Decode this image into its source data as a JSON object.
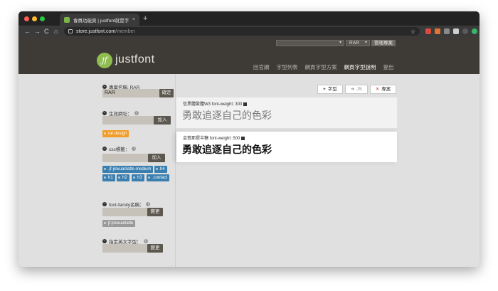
{
  "browser": {
    "tab_title": "會員功能頁 | justfont就是字・線上…",
    "tab_close": "×",
    "new_tab": "+",
    "url_host": "store.justfont.com",
    "url_path": "/member",
    "nav_back": "←",
    "nav_forward": "→",
    "nav_reload": "C",
    "nav_home": "⌂",
    "star": "☆"
  },
  "site": {
    "logo_mark": "jf",
    "logo_text": "justfont",
    "project_select": "RAR",
    "manage_button": "管理專案",
    "nav": [
      {
        "label": "回官網"
      },
      {
        "label": "字型列表"
      },
      {
        "label": "網頁字型方案"
      },
      {
        "label": "網頁字型說明"
      },
      {
        "label": "登出"
      }
    ]
  },
  "sidebar": {
    "project_name_label": "專案名稱: RAR",
    "project_name_value": "RAR",
    "confirm_button": "確定",
    "domain_label": "生效網址：",
    "add_button": "加入",
    "domain_tags": [
      "rar.design"
    ],
    "css_label": "css標籤：",
    "css_add_button": "加入",
    "css_tags": [
      ".jf-jinxuanlatte-medium",
      "h4",
      "h1",
      "h2",
      "h3",
      ".contact"
    ],
    "font_family_label": "font-family名稱：",
    "change_button": "變更",
    "font_family_tags": [
      "jf-jinxuanlatte"
    ],
    "english_font_label": "指定英文字型：",
    "english_change_button": "變更"
  },
  "actions": {
    "add_font": "字型",
    "js": "JS",
    "project": "專案"
  },
  "fonts": [
    {
      "meta": "信黑體繁體W3 font-weight: 300",
      "sample": "勇敢追逐自己的色彩"
    },
    {
      "meta": "金萱那提半糖 font-weight: 500",
      "sample": "勇敢追逐自己的色彩"
    }
  ],
  "colors": {
    "header_bg": "#3e3a35",
    "accent_green": "#8fbd4f",
    "tag_orange": "#f39c28",
    "tag_blue": "#3b7fb0",
    "button_dark": "#5c574f"
  }
}
